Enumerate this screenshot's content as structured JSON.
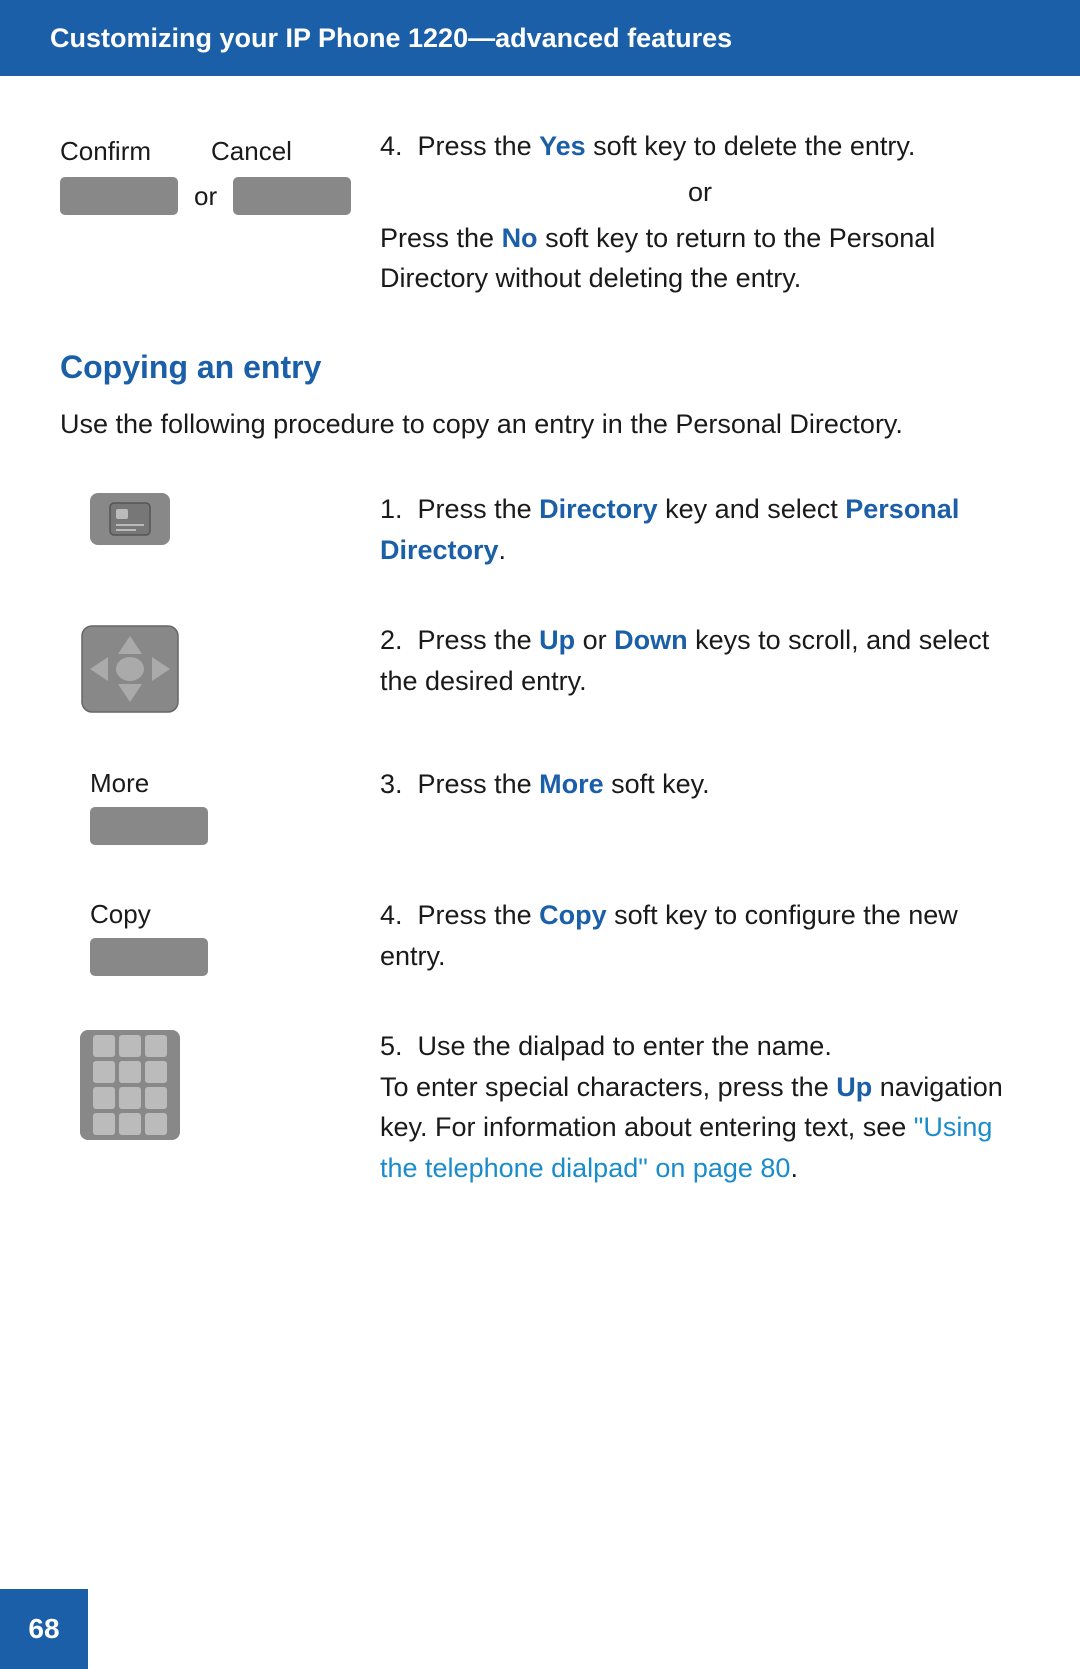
{
  "header": {
    "title": "Customizing your IP Phone 1220—advanced features"
  },
  "top_section": {
    "confirm_label": "Confirm",
    "cancel_label": "Cancel",
    "or_text": "or",
    "step4a": {
      "number": "4.",
      "text_before": "Press the ",
      "yes_key": "Yes",
      "text_after": " soft key to delete the entry."
    },
    "or_inline": "or",
    "step4b": {
      "text_before": "Press the ",
      "no_key": "No",
      "text_after": " soft key to return to the Personal Directory without deleting the entry."
    }
  },
  "copying_section": {
    "heading": "Copying an entry",
    "intro": "Use the following procedure to copy an entry in the Personal Directory.",
    "steps": [
      {
        "number": "1.",
        "text_before": "Press the ",
        "key1": "Directory",
        "text_middle": " key and select ",
        "key2": "Personal Directory",
        "text_after": "."
      },
      {
        "number": "2.",
        "text_before": "Press the ",
        "key1": "Up",
        "text_middle": " or ",
        "key2": "Down",
        "text_after": " keys to scroll, and select the desired entry."
      },
      {
        "number": "3.",
        "label": "More",
        "text_before": "Press the ",
        "key1": "More",
        "text_after": " soft key."
      },
      {
        "number": "4.",
        "label": "Copy",
        "text_before": "Press the ",
        "key1": "Copy",
        "text_after": " soft key to configure the new entry."
      },
      {
        "number": "5.",
        "line1": "Use the dialpad to enter the name.",
        "line2": "To enter special characters, press the ",
        "key1": "Up",
        "line3": " navigation key. For information about entering text, see ",
        "link_text": "\"Using the telephone dialpad\" on page 80",
        "line4": "."
      }
    ]
  },
  "page_number": "68"
}
